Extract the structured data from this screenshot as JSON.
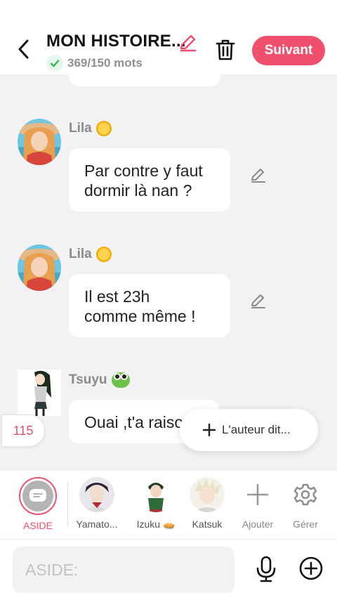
{
  "header": {
    "title": "MON HISTOIRE...",
    "word_count": "369/150 mots",
    "next_label": "Suivant"
  },
  "messages": [
    {
      "speaker": "Lila",
      "emoji": "sun",
      "text_line1": "Par contre y faut",
      "text_line2": "dormir là nan ?"
    },
    {
      "speaker": "Lila",
      "emoji": "sun",
      "text_line1": "Il est 23h",
      "text_line2": "comme même !"
    },
    {
      "speaker": "Tsuyu",
      "emoji": "frog",
      "text_line1": "Ouai ,t'a raiso"
    }
  ],
  "counter_badge": "115",
  "author_says": "L'auteur dit...",
  "characters": [
    {
      "label": "ASIDE"
    },
    {
      "label": "Yamato..."
    },
    {
      "label": "Izuku 🥧"
    },
    {
      "label": "Katsuk"
    },
    {
      "label": "Ajouter"
    },
    {
      "label": "Gérer"
    }
  ],
  "input": {
    "placeholder": "ASIDE:"
  },
  "colors": {
    "accent": "#f0506e",
    "check": "#3bb55f",
    "background": "#f2f2f4"
  }
}
